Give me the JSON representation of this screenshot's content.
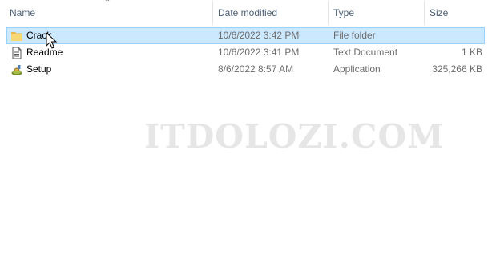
{
  "columns": {
    "name": "Name",
    "date_modified": "Date modified",
    "type": "Type",
    "size": "Size"
  },
  "sort": {
    "column": "name",
    "direction": "ascending",
    "icon": "caret-up-icon"
  },
  "rows": [
    {
      "name": "Crack",
      "date": "10/6/2022 3:42 PM",
      "type": "File folder",
      "size": "",
      "icon": "folder-icon",
      "selected": true
    },
    {
      "name": "Readme",
      "date": "10/6/2022 3:41 PM",
      "type": "Text Document",
      "size": "1 KB",
      "icon": "text-document-icon",
      "selected": false
    },
    {
      "name": "Setup",
      "date": "8/6/2022 8:57 AM",
      "type": "Application",
      "size": "325,266 KB",
      "icon": "setup-package-icon",
      "selected": false
    }
  ],
  "watermark": "ITDOLOZI.COM",
  "colors": {
    "selection_bg": "#cce8ff",
    "selection_border": "#99d1ff",
    "header_text": "#4c607a",
    "detail_text": "#6d6d6d",
    "folder": "#f8d775"
  }
}
